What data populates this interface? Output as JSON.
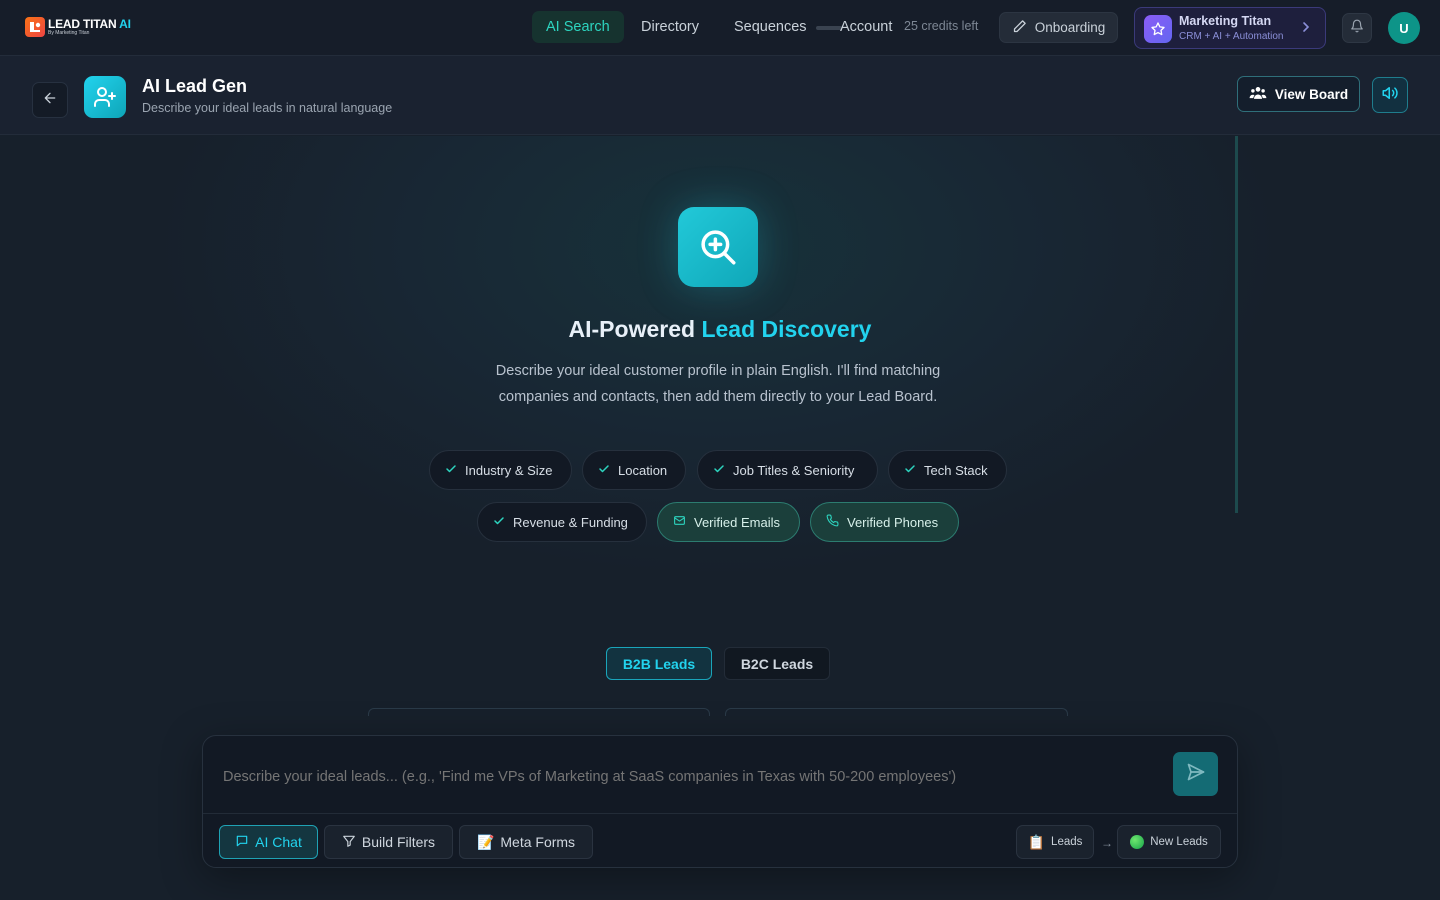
{
  "brand": {
    "name": "LEAD TITAN",
    "ai": "AI",
    "tagline": "By Marketing Titan"
  },
  "nav": {
    "links": [
      "AI Search",
      "Directory",
      "Sequences",
      "Account"
    ],
    "active": "AI Search",
    "credits": "25 credits left",
    "onboarding_label": "Onboarding"
  },
  "marketing_card": {
    "title": "Marketing Titan",
    "subtitle": "CRM + AI + Automation"
  },
  "user": {
    "initial": "U"
  },
  "page": {
    "title": "AI Lead Gen",
    "subtitle": "Describe your ideal leads in natural language",
    "view_board_label": "View Board"
  },
  "hero": {
    "title_part1": "AI-Powered",
    "title_part2": "Lead Discovery",
    "description": "Describe your ideal customer profile in plain English. I'll find matching companies and contacts, then add them directly to your Lead Board."
  },
  "features": [
    {
      "label": "Industry & Size",
      "icon": "check-icon"
    },
    {
      "label": "Location",
      "icon": "check-icon"
    },
    {
      "label": "Job Titles & Seniority",
      "icon": "check-icon"
    },
    {
      "label": "Tech Stack",
      "icon": "check-icon"
    },
    {
      "label": "Revenue & Funding",
      "icon": "check-icon"
    },
    {
      "label": "Verified Emails",
      "icon": "mail-icon"
    },
    {
      "label": "Verified Phones",
      "icon": "phone-icon"
    }
  ],
  "lead_tabs": {
    "b2b": "B2B Leads",
    "b2c": "B2C Leads",
    "active": "B2B Leads"
  },
  "composer": {
    "placeholder": "Describe your ideal leads... (e.g., 'Find me VPs of Marketing at SaaS companies in Texas with 50-200 employees')",
    "modes": [
      "AI Chat",
      "Build Filters",
      "Meta Forms"
    ],
    "active_mode": "AI Chat",
    "destination_from": "Leads",
    "destination_to": "New Leads"
  },
  "colors": {
    "accent": "#22d3ee",
    "teal": "#2dd4bf",
    "purple": "#8b5cf6",
    "background": "#17202b"
  }
}
